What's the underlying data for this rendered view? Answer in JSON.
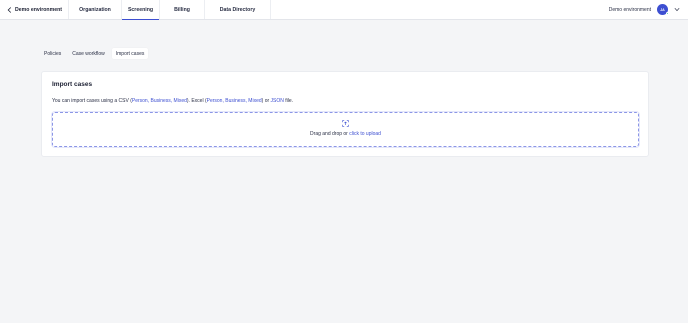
{
  "topbar": {
    "back_label": "Demo environment",
    "tabs": [
      {
        "label": "Organization"
      },
      {
        "label": "Screening"
      },
      {
        "label": "Billing"
      },
      {
        "label": "Data Directory"
      }
    ],
    "active_tab": "Screening",
    "environment_label": "Demo environment",
    "avatar_initials": "JA"
  },
  "subtabs": [
    {
      "label": "Policies"
    },
    {
      "label": "Case workflow"
    },
    {
      "label": "Import cases"
    }
  ],
  "card": {
    "title": "Import cases",
    "desc": {
      "t1": "You can import cases using a CSV (",
      "csv_link": "Person, Business, Mixed",
      "t2": "). Excel (",
      "excel_link": "Person, Business, Mixed",
      "t3": ") or ",
      "json_link": "JSON",
      "t4": " file."
    },
    "dropzone": {
      "text": "Drag and drop or ",
      "link": "click to upload"
    }
  },
  "colors": {
    "accent": "#3d4fd1",
    "status_online": "#2ecf8f"
  }
}
